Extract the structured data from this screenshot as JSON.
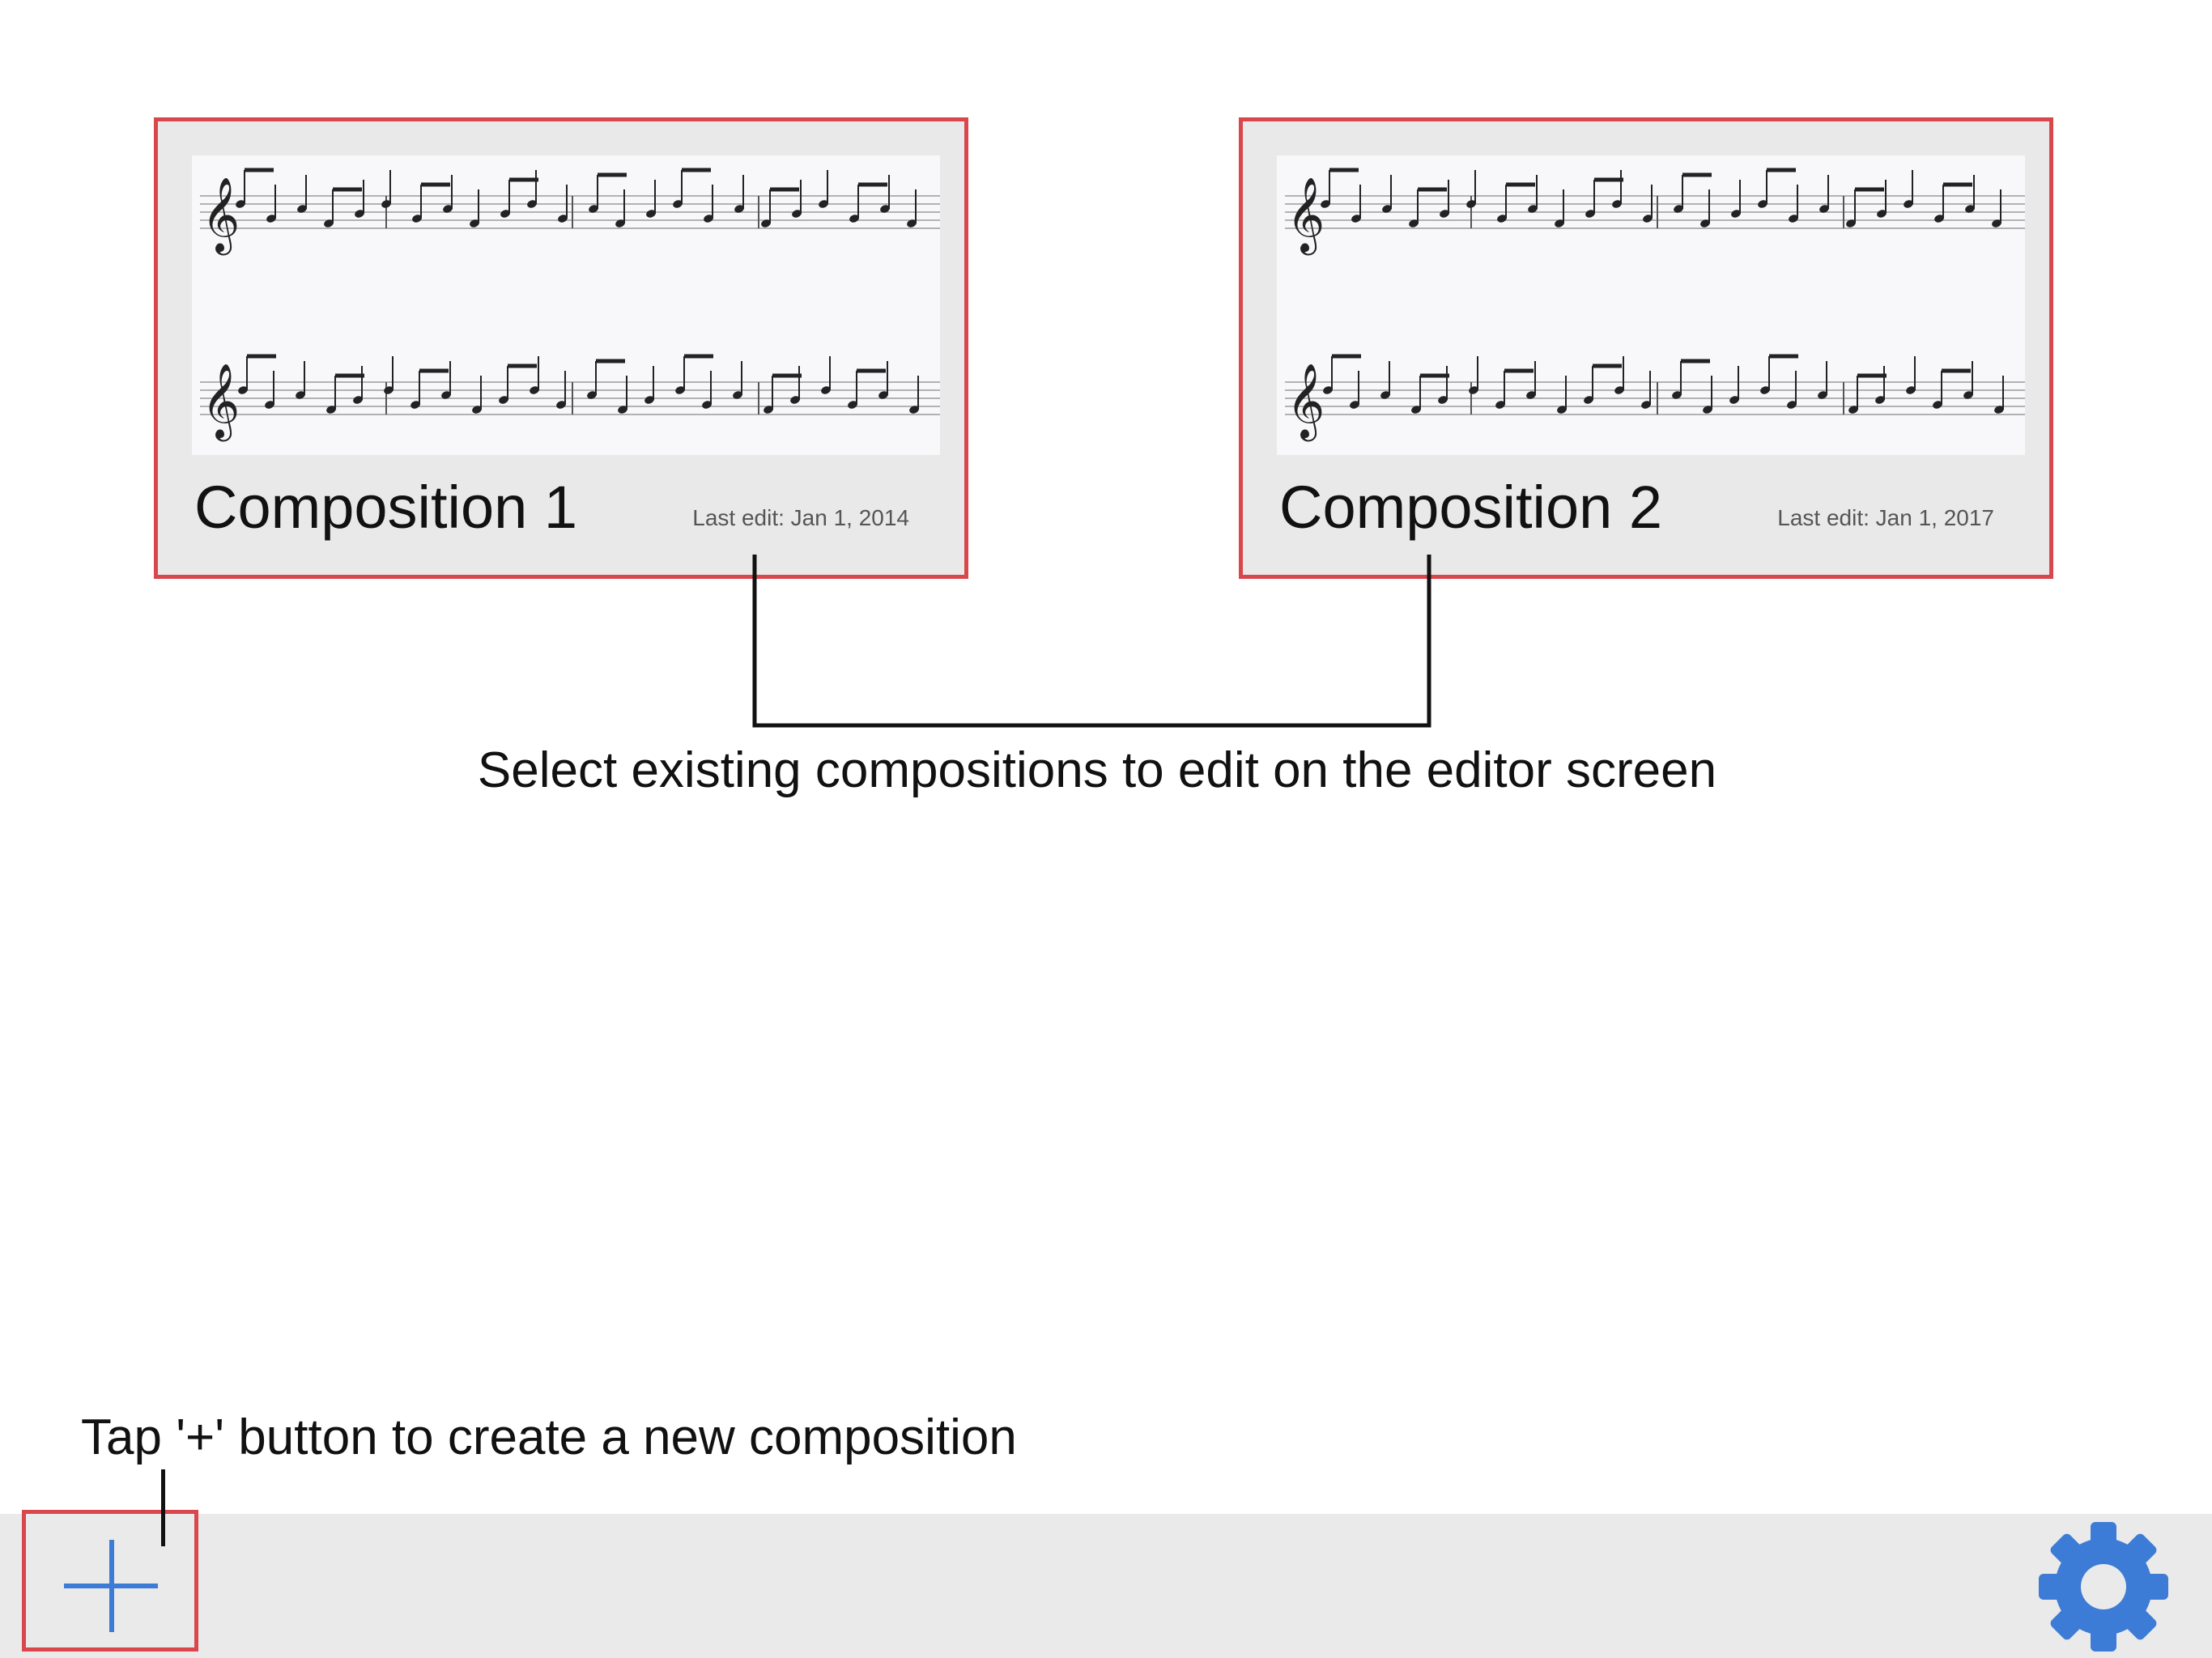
{
  "compositions": [
    {
      "title": "Composition 1",
      "last_edit": "Last edit: Jan 1, 2014"
    },
    {
      "title": "Composition 2",
      "last_edit": "Last edit: Jan 1, 2017"
    }
  ],
  "annotations": {
    "select_hint": "Select existing compositions to edit on the editor screen",
    "add_hint": "Tap '+' button to create a new composition"
  },
  "toolbar": {
    "add_icon": "plus-icon",
    "settings_icon": "gear-icon"
  },
  "colors": {
    "highlight_border": "#d9474d",
    "accent_blue": "#3d7cd6",
    "card_background": "#e9e9e9",
    "toolbar_background": "#eaeaea"
  }
}
